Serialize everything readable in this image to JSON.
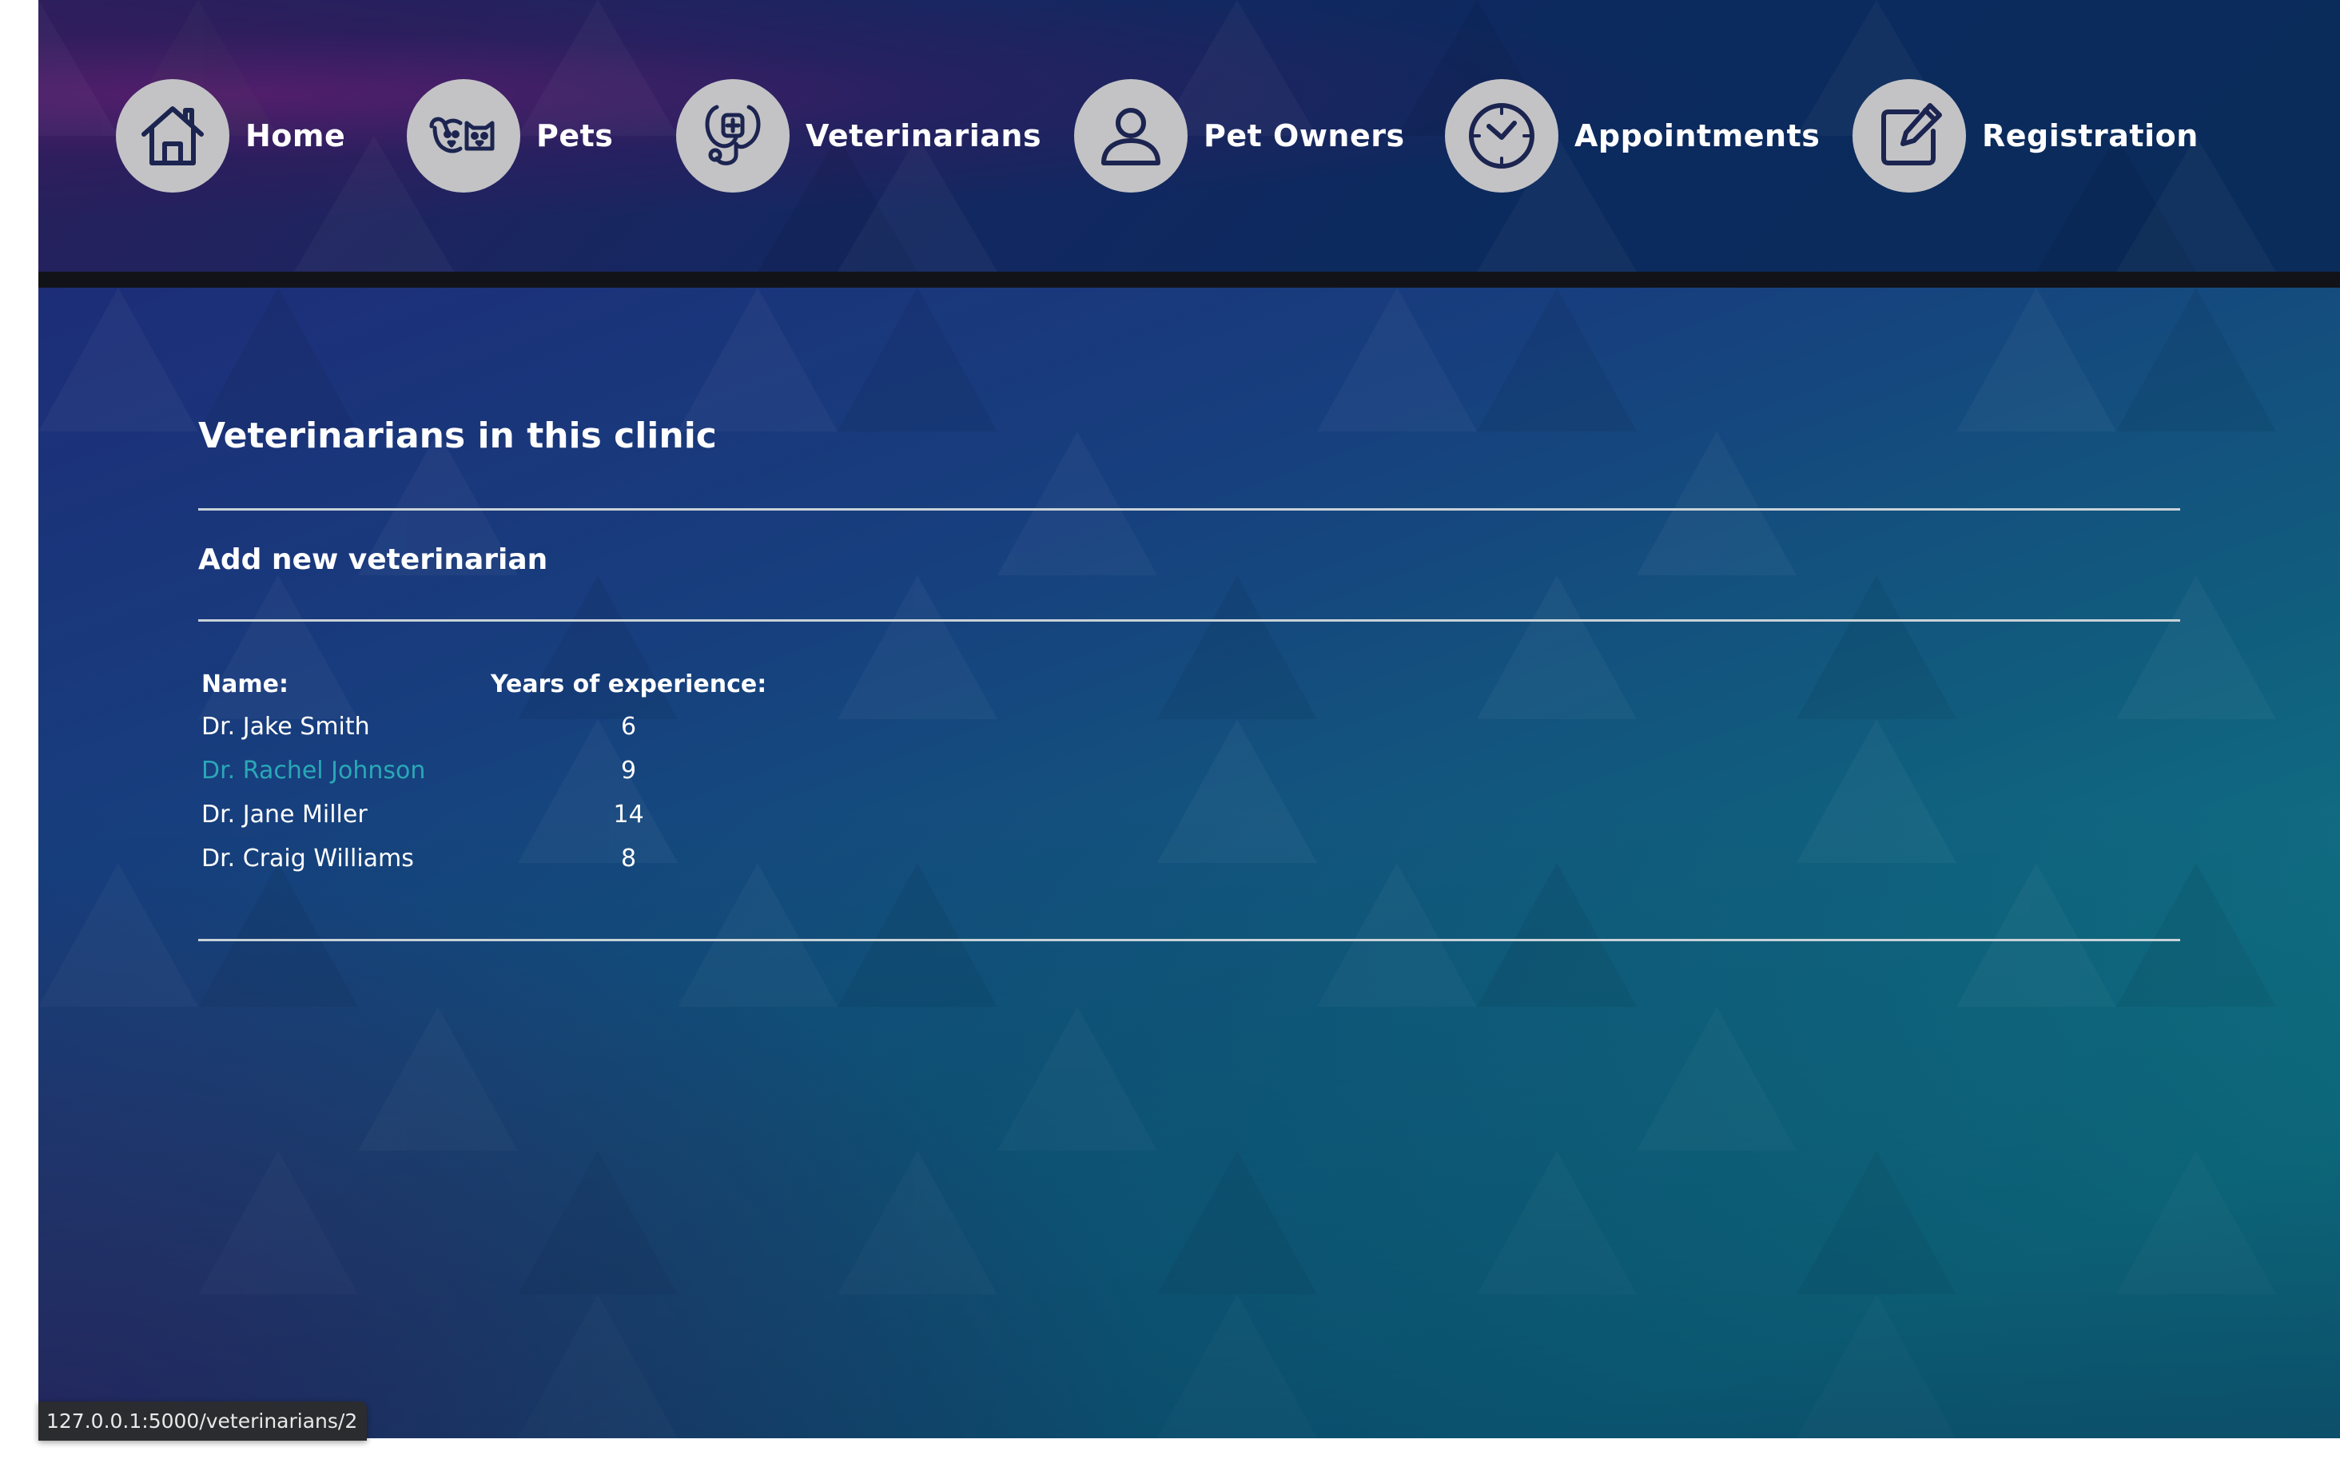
{
  "nav": {
    "items": [
      {
        "label": "Home",
        "icon": "house-icon"
      },
      {
        "label": "Pets",
        "icon": "dog-cat-icon"
      },
      {
        "label": "Veterinarians",
        "icon": "stethoscope-icon"
      },
      {
        "label": "Pet Owners",
        "icon": "person-icon"
      },
      {
        "label": "Appointments",
        "icon": "clock-icon"
      },
      {
        "label": "Registration",
        "icon": "edit-icon"
      }
    ]
  },
  "main": {
    "title": "Veterinarians in this clinic",
    "add_link": "Add new veterinarian",
    "table": {
      "headers": [
        "Name:",
        "Years of experience:"
      ],
      "rows": [
        {
          "name": "Dr. Jake Smith",
          "years": "6"
        },
        {
          "name": "Dr. Rachel Johnson",
          "years": "9"
        },
        {
          "name": "Dr. Jane Miller",
          "years": "14"
        },
        {
          "name": "Dr. Craig Williams",
          "years": "8"
        }
      ]
    }
  },
  "status_bar": {
    "url": "127.0.0.1:5000/veterinarians/2"
  },
  "colors": {
    "icon_stroke": "#1c2450",
    "icon_bg": "#c3c3c6",
    "link_hover": "#2aa8b6",
    "rule": "#c8d2d8"
  }
}
